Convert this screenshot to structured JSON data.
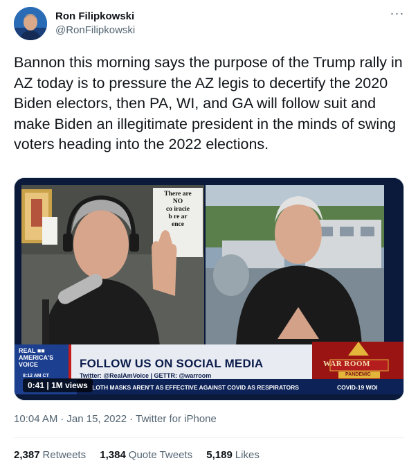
{
  "author": {
    "display_name": "Ron Filipkowski",
    "handle": "@RonFilipkowski"
  },
  "more_icon": "more-horizontal-icon",
  "tweet_text": "Bannon this morning says the purpose of the Trump rally in AZ today is to pressure the AZ legis to decertify the 2020 Biden electors, then PA, WI, and GA will follow suit and make Biden an illegitimate president in the minds of swing voters heading into the 2022 elections.",
  "video": {
    "timestamp": "0:41",
    "views": "1M views",
    "banner_title": "FOLLOW US ON SOCIAL MEDIA",
    "banner_sub": "Twitter: @RealAmVoice | GETTR: @warroom",
    "ticker_time": "8:12 AM CT",
    "ticker_text": "LOTH MASKS AREN'T AS EFFECTIVE AGAINST COVID AS RESPIRATORS",
    "ticker_tag": "COVID-19 WOI",
    "network_logo": "REAL AMERICA'S VOICE",
    "show_logo": "WAR ROOM PANDEMIC",
    "sign_text": "There are NO co iracie b re ar ence"
  },
  "meta": {
    "time": "10:04 AM",
    "date": "Jan 15, 2022",
    "source": "Twitter for iPhone"
  },
  "stats": {
    "retweets_count": "2,387",
    "retweets_label": "Retweets",
    "quotes_count": "1,384",
    "quotes_label": "Quote Tweets",
    "likes_count": "5,189",
    "likes_label": "Likes"
  },
  "colors": {
    "text_primary": "#0f1419",
    "text_secondary": "#536471",
    "divider": "#eff3f4"
  }
}
